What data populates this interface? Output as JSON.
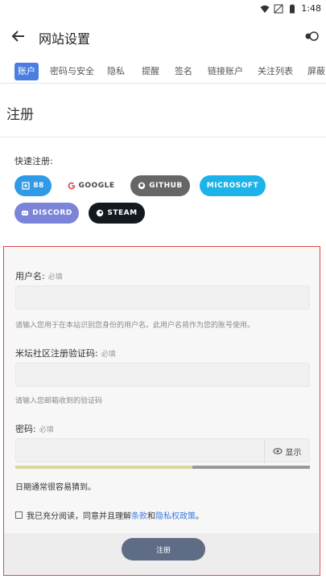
{
  "status_bar": {
    "time": "1:48",
    "icons": [
      "wifi-icon",
      "signal-icon",
      "battery-icon"
    ]
  },
  "app_bar": {
    "title": "网站设置",
    "back_icon": "arrow-left-icon",
    "right_icon": "toggle-icon"
  },
  "tabs": [
    "账户",
    "密码与安全",
    "隐私",
    "提醒",
    "签名",
    "链接账户",
    "关注列表",
    "屏蔽"
  ],
  "active_tab": 0,
  "section_title": "注册",
  "quick_register": {
    "label": "快速注册:",
    "providers": [
      {
        "label": "88",
        "color": "#2f9ae6",
        "icon": "88-icon"
      },
      {
        "label": "GOOGLE",
        "color": "#ffffff",
        "icon": "google-icon"
      },
      {
        "label": "GITHUB",
        "color": "#666666",
        "icon": "github-icon"
      },
      {
        "label": "MICROSOFT",
        "color": "#1cb3eb",
        "icon": "microsoft-icon"
      },
      {
        "label": "DISCORD",
        "color": "#7b84d8",
        "icon": "discord-icon"
      },
      {
        "label": "STEAM",
        "color": "#14181f",
        "icon": "steam-icon"
      }
    ]
  },
  "form": {
    "username": {
      "label": "用户名:",
      "required": "必填",
      "value": "",
      "help": "请输入您用于在本站识别您身份的用户名。此用户名将作为您的账号使用。"
    },
    "code": {
      "label": "米坛社区注册验证码:",
      "required": "必填",
      "value": "",
      "help": "请输入您邮箱收到的验证码"
    },
    "password": {
      "label": "密码:",
      "required": "必填",
      "value": "",
      "show_label": "显示",
      "show_icon": "eye-icon",
      "strength": 0.6,
      "strength_text": "日期通常很容易猜到。"
    },
    "agree": {
      "prefix": "我已充分阅读，同意并且理解",
      "terms": "条款",
      "and": "和",
      "privacy": "隐私权政策",
      "suffix": "。"
    },
    "submit_label": "注册"
  }
}
